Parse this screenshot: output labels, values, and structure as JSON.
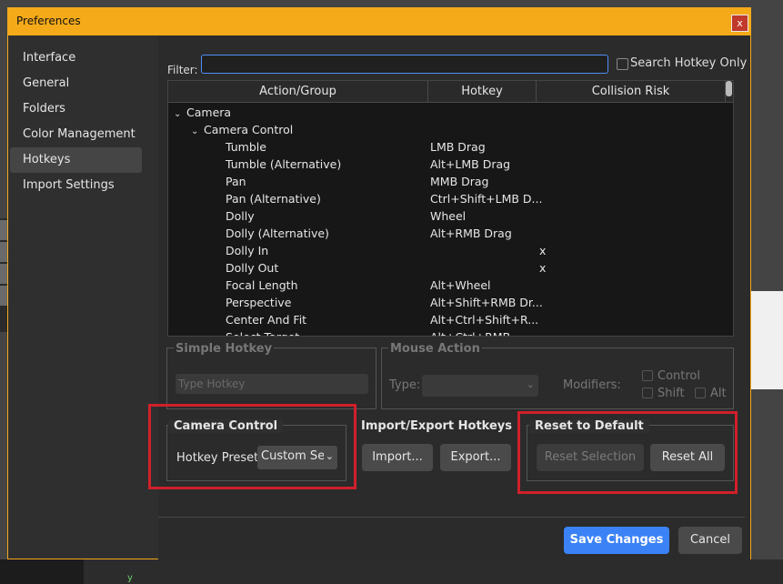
{
  "window": {
    "title": "Preferences",
    "close_label": "x"
  },
  "sidebar": {
    "items": [
      {
        "label": "Interface",
        "active": false
      },
      {
        "label": "General",
        "active": false
      },
      {
        "label": "Folders",
        "active": false
      },
      {
        "label": "Color Management",
        "active": false
      },
      {
        "label": "Hotkeys",
        "active": true
      },
      {
        "label": "Import Settings",
        "active": false
      }
    ]
  },
  "filter": {
    "label": "Filter:",
    "value": "",
    "search_hotkey_only_label": "Search Hotkey Only",
    "search_hotkey_only_checked": false
  },
  "table": {
    "headers": [
      "Action/Group",
      "Hotkey",
      "Collision Risk"
    ],
    "rows": [
      {
        "level": 0,
        "expand": "open",
        "action": "Camera",
        "hotkey": "",
        "risk": ""
      },
      {
        "level": 1,
        "expand": "open",
        "action": "Camera Control",
        "hotkey": "",
        "risk": ""
      },
      {
        "level": 2,
        "action": "Tumble",
        "hotkey": "LMB Drag",
        "risk": ""
      },
      {
        "level": 2,
        "action": "Tumble (Alternative)",
        "hotkey": "Alt+LMB Drag",
        "risk": ""
      },
      {
        "level": 2,
        "action": "Pan",
        "hotkey": "MMB Drag",
        "risk": ""
      },
      {
        "level": 2,
        "action": "Pan (Alternative)",
        "hotkey": "Ctrl+Shift+LMB D...",
        "risk": ""
      },
      {
        "level": 2,
        "action": "Dolly",
        "hotkey": "Wheel",
        "risk": ""
      },
      {
        "level": 2,
        "action": "Dolly (Alternative)",
        "hotkey": "Alt+RMB Drag",
        "risk": ""
      },
      {
        "level": 2,
        "action": "Dolly In",
        "hotkey": "",
        "risk": "x"
      },
      {
        "level": 2,
        "action": "Dolly Out",
        "hotkey": "",
        "risk": "x"
      },
      {
        "level": 2,
        "action": "Focal Length",
        "hotkey": "Alt+Wheel",
        "risk": ""
      },
      {
        "level": 2,
        "action": "Perspective",
        "hotkey": "Alt+Shift+RMB Dr...",
        "risk": ""
      },
      {
        "level": 2,
        "action": "Center And Fit",
        "hotkey": "Alt+Ctrl+Shift+R...",
        "risk": ""
      },
      {
        "level": 2,
        "action": "Select Target",
        "hotkey": "Alt+Ctrl+RMB",
        "risk": ""
      }
    ]
  },
  "simple_hotkey": {
    "title": "Simple Hotkey",
    "placeholder": "Type Hotkey"
  },
  "mouse_action": {
    "title": "Mouse Action",
    "type_label": "Type:",
    "modifiers_label": "Modifiers:",
    "control_label": "Control",
    "shift_label": "Shift",
    "alt_label": "Alt"
  },
  "camera_control": {
    "title": "Camera Control",
    "preset_label": "Hotkey Preset:",
    "preset_value": "Custom Set"
  },
  "import_export": {
    "title": "Import/Export Hotkeys",
    "import_label": "Import...",
    "export_label": "Export..."
  },
  "reset": {
    "title": "Reset to Default",
    "reset_selection_label": "Reset Selection",
    "reset_all_label": "Reset All"
  },
  "footer": {
    "save_label": "Save Changes",
    "cancel_label": "Cancel"
  },
  "background": {
    "axis_label": "y"
  },
  "colors": {
    "accent": "#f5aa19",
    "primary_button": "#3b82f6",
    "highlight": "#d0202a"
  }
}
